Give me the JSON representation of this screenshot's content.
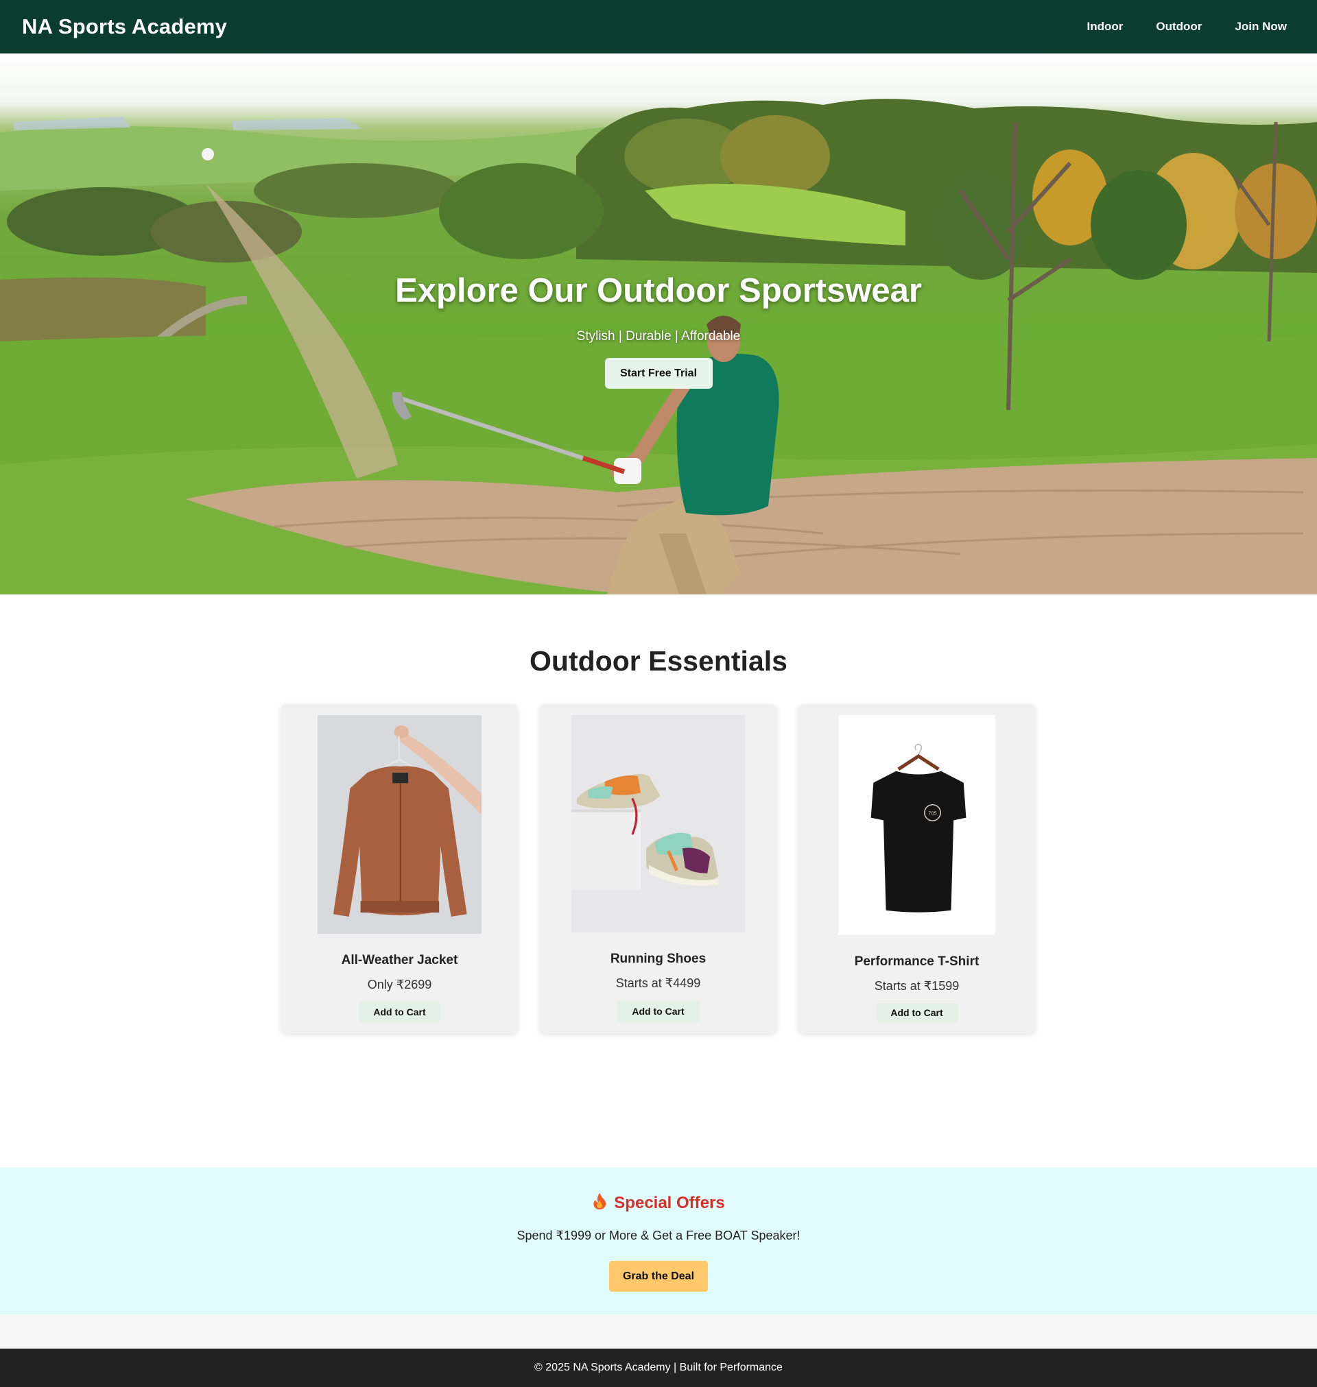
{
  "nav": {
    "brand": "NA Sports Academy",
    "links": [
      "Indoor",
      "Outdoor",
      "Join Now"
    ]
  },
  "hero": {
    "title": "Explore Our Outdoor Sportswear",
    "subtitle": "Stylish | Durable | Affordable",
    "cta_label": "Start Free Trial"
  },
  "essentials": {
    "title": "Outdoor Essentials",
    "products": [
      {
        "name": "All-Weather Jacket",
        "price": "Only ₹2699",
        "button": "Add to Cart",
        "image": "rust-bomber-jacket-on-hanger"
      },
      {
        "name": "Running Shoes",
        "price": "Starts at ₹4499",
        "button": "Add to Cart",
        "image": "colorful-running-sneakers"
      },
      {
        "name": "Performance T-Shirt",
        "price": "Starts at ₹1599",
        "button": "Add to Cart",
        "image": "black-tshirt-on-hanger"
      }
    ]
  },
  "offers": {
    "icon": "fire-icon",
    "title": "Special Offers",
    "text": "Spend ₹1999 or More & Get a Free BOAT Speaker!",
    "button": "Grab the Deal"
  },
  "footer": {
    "text": "© 2025 NA Sports Academy | Built for Performance"
  },
  "colors": {
    "nav_bg": "#0b3d2e",
    "offers_bg": "#e0fbfc",
    "offers_title": "#d62f26",
    "deal_button": "#ffc86b",
    "footer_bg": "#222222"
  }
}
